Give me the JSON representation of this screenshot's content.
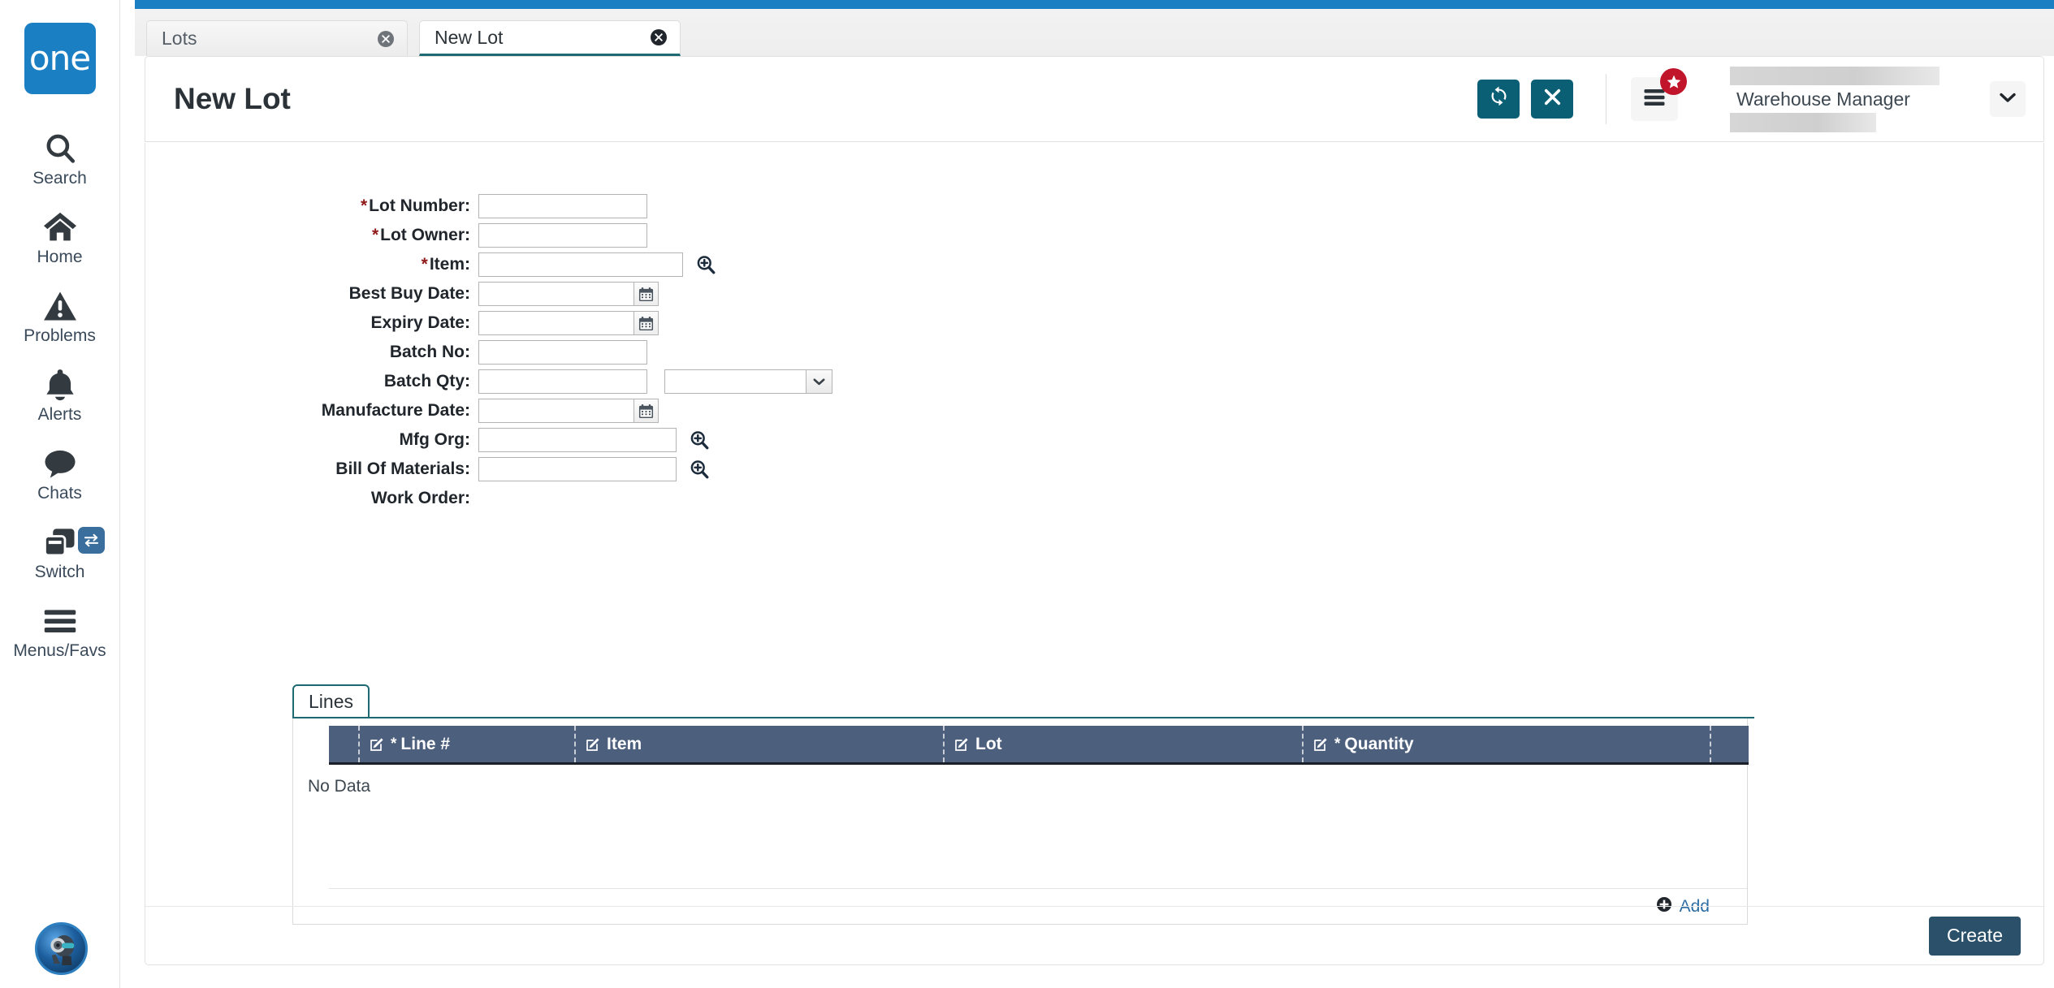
{
  "brand": {
    "logo_text": "one",
    "logo_color": "#1b7fc4"
  },
  "sidebar": {
    "items": [
      {
        "label": "Search",
        "icon": "search-icon"
      },
      {
        "label": "Home",
        "icon": "home-icon"
      },
      {
        "label": "Problems",
        "icon": "warning-triangle-icon"
      },
      {
        "label": "Alerts",
        "icon": "bell-icon"
      },
      {
        "label": "Chats",
        "icon": "chat-bubble-icon"
      },
      {
        "label": "Switch",
        "icon": "switch-windows-icon",
        "badge_icon": "swap-arrows-icon"
      },
      {
        "label": "Menus/Favs",
        "icon": "hamburger-icon"
      }
    ],
    "avatar": "user-avatar"
  },
  "tabs": [
    {
      "label": "Lots",
      "active": false,
      "close_icon": "close-circle-icon"
    },
    {
      "label": "New Lot",
      "active": true,
      "close_icon": "close-circle-icon"
    }
  ],
  "header": {
    "title": "New Lot",
    "refresh_icon": "refresh-icon",
    "close_icon": "close-x-icon",
    "menu_icon": "list-menu-icon",
    "star_badge_icon": "star-icon",
    "user_role": "Warehouse Manager",
    "caret_icon": "chevron-down-icon",
    "accent_teal": "#0b5f74",
    "badge_red": "#c0152a"
  },
  "form": {
    "fields": [
      {
        "label": "Lot Number",
        "required": true,
        "value": "",
        "control": "text",
        "width": "w-medium"
      },
      {
        "label": "Lot Owner",
        "required": true,
        "value": "",
        "control": "text",
        "width": "w-medium"
      },
      {
        "label": "Item",
        "required": true,
        "value": "",
        "control": "text-lookup",
        "width": "w-wide",
        "lookup_icon": "magnifier-plus-icon"
      },
      {
        "label": "Best Buy Date",
        "required": false,
        "value": "",
        "control": "date",
        "width": "w-date",
        "calendar_icon": "calendar-icon"
      },
      {
        "label": "Expiry Date",
        "required": false,
        "value": "",
        "control": "date",
        "width": "w-date",
        "calendar_icon": "calendar-icon"
      },
      {
        "label": "Batch No",
        "required": false,
        "value": "",
        "control": "text",
        "width": "w-medium"
      },
      {
        "label": "Batch Qty",
        "required": false,
        "value": "",
        "control": "text-select",
        "width": "w-medium",
        "select_value": "",
        "select_icon": "chevron-down-icon"
      },
      {
        "label": "Manufacture Date",
        "required": false,
        "value": "",
        "control": "date",
        "width": "w-date",
        "calendar_icon": "calendar-icon"
      },
      {
        "label": "Mfg Org",
        "required": false,
        "value": "",
        "control": "text-lookup",
        "width": "w-lookup",
        "lookup_icon": "magnifier-plus-icon"
      },
      {
        "label": "Bill Of Materials",
        "required": false,
        "value": "",
        "control": "text-lookup",
        "width": "w-lookup",
        "lookup_icon": "magnifier-plus-icon"
      },
      {
        "label": "Work Order",
        "required": false,
        "value": "",
        "control": "none"
      }
    ]
  },
  "lines": {
    "tab_label": "Lines",
    "columns": [
      {
        "label": "Line #",
        "required": true,
        "edit_icon": "pencil-edit-icon"
      },
      {
        "label": "Item",
        "required": false,
        "edit_icon": "pencil-edit-icon"
      },
      {
        "label": "Lot",
        "required": false,
        "edit_icon": "pencil-edit-icon"
      },
      {
        "label": "Quantity",
        "required": true,
        "edit_icon": "pencil-edit-icon"
      }
    ],
    "rows": [],
    "empty_text": "No Data",
    "add_label": "Add",
    "add_icon": "plus-circle-icon",
    "header_bg": "#4c5f7c"
  },
  "footer": {
    "create_label": "Create",
    "create_color": "#2b5069"
  }
}
